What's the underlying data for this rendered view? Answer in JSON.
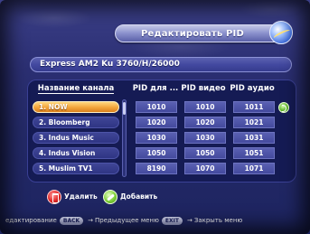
{
  "title": "Редактировать PID",
  "satellite": "Express AM2 Ku 3760/H/26000",
  "headers": {
    "name": "Название канала",
    "pid_ts": "PID для ...",
    "pid_video": "PID видео",
    "pid_audio": "PID аудио"
  },
  "channels": [
    {
      "label": "1. NOW",
      "pid_ts": "1010",
      "pid_video": "1010",
      "pid_audio": "1011",
      "selected": true
    },
    {
      "label": "2. Bloomberg",
      "pid_ts": "1020",
      "pid_video": "1020",
      "pid_audio": "1021"
    },
    {
      "label": "3. Indus Music",
      "pid_ts": "1030",
      "pid_video": "1030",
      "pid_audio": "1031"
    },
    {
      "label": "4. Indus Vision",
      "pid_ts": "1050",
      "pid_video": "1050",
      "pid_audio": "1051"
    },
    {
      "label": "5. Muslim TV1",
      "pid_ts": "8190",
      "pid_video": "1070",
      "pid_audio": "1071"
    }
  ],
  "actions": {
    "delete_label": "Удалить",
    "add_label": "Добавить"
  },
  "hints": {
    "edit": "едактирование",
    "back_key": "BACK",
    "back_label": "Предыдущее меню",
    "exit_key": "EXIT",
    "exit_label": "Закрыть меню"
  },
  "icons": {
    "title": "globe-icon",
    "audio": "audio-switch-icon",
    "delete": "trash-icon",
    "add": "pencil-icon"
  },
  "colors": {
    "selected_row": "#f2a43a",
    "background": "#2b2f72",
    "cell": "#4b51a5"
  }
}
